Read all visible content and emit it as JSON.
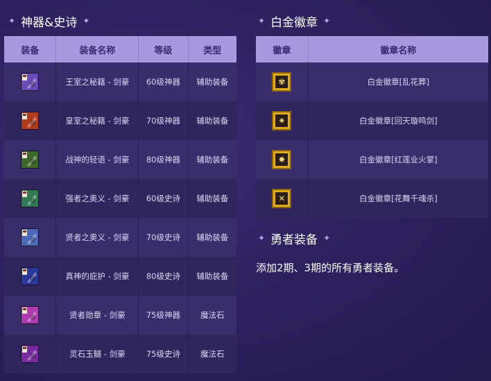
{
  "left": {
    "title": "神器&史诗",
    "headers": [
      "装备",
      "装备名称",
      "等级",
      "类型"
    ],
    "rows": [
      {
        "name": "王室之秘籍 - 剑豪",
        "level": "60级神器",
        "type": "辅助装备",
        "icon": "spellbook-icon",
        "color": "#6b4bb8"
      },
      {
        "name": "皇室之秘籍 - 剑豪",
        "level": "70级神器",
        "type": "辅助装备",
        "icon": "spellbook-icon",
        "color": "#b23a1e"
      },
      {
        "name": "战神的轻语 - 剑豪",
        "level": "80级神器",
        "type": "辅助装备",
        "icon": "horn-icon",
        "color": "#3d6a2a"
      },
      {
        "name": "强者之奥义 - 剑豪",
        "level": "60级史诗",
        "type": "辅助装备",
        "icon": "scroll-icon",
        "color": "#2f7a55"
      },
      {
        "name": "贤者之奥义 - 剑豪",
        "level": "70级史诗",
        "type": "辅助装备",
        "icon": "feather-icon",
        "color": "#4a6ab8"
      },
      {
        "name": "真神的庇护 - 剑豪",
        "level": "80级史诗",
        "type": "辅助装备",
        "icon": "orb-icon",
        "color": "#2a3a9a"
      },
      {
        "name": "贤者勋章 - 剑豪",
        "level": "75级神器",
        "type": "魔法石",
        "icon": "medal-icon",
        "color": "#b03bb0"
      },
      {
        "name": "灵石玉髓 - 剑豪",
        "level": "75级史诗",
        "type": "魔法石",
        "icon": "gem-icon",
        "color": "#7a2aa0"
      }
    ]
  },
  "right": {
    "title": "白金徽章",
    "headers": [
      "徽章",
      "徽章名称"
    ],
    "rows": [
      {
        "name": "白金徽章[乱花葬]",
        "icon": "flower-badge-icon",
        "glyph": "✾"
      },
      {
        "name": "白金徽章[回天璇鸣剑]",
        "icon": "spin-badge-icon",
        "glyph": "✷"
      },
      {
        "name": "白金徽章[红莲业火掌]",
        "icon": "flame-badge-icon",
        "glyph": "✸"
      },
      {
        "name": "白金徽章[花舞千魂杀]",
        "icon": "sword-badge-icon",
        "glyph": "✕"
      }
    ]
  },
  "hero": {
    "title": "勇者装备",
    "text": "添加2期、3期的所有勇者装备。"
  }
}
